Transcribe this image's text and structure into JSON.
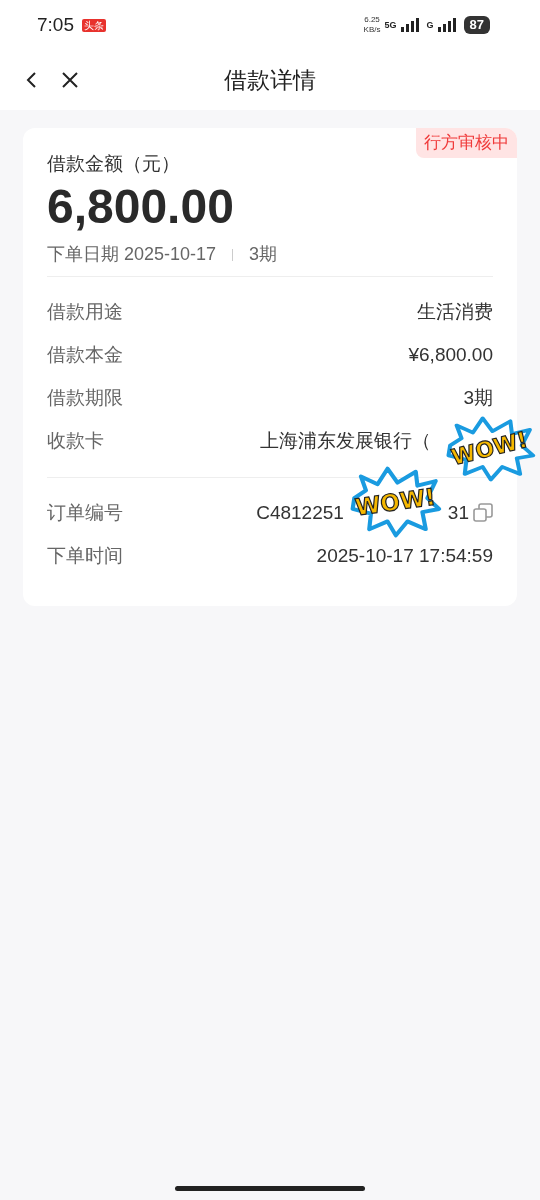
{
  "status_bar": {
    "time": "7:05",
    "app_badge": "头条",
    "net_speed": "6.25",
    "net_unit": "KB/s",
    "network_1": "5G",
    "network_2": "G",
    "battery": "87"
  },
  "header": {
    "title": "借款详情"
  },
  "card": {
    "status_tag": "行方审核中",
    "amount_label": "借款金额（元）",
    "amount": "6,800.00",
    "date_text": "下单日期 2025-10-17",
    "term_text": "3期",
    "rows": [
      {
        "kind": "plain",
        "label": "借款用途",
        "value": "生活消费"
      },
      {
        "kind": "plain",
        "label": "借款本金",
        "value": "¥6,800.00"
      },
      {
        "kind": "plain",
        "label": "借款期限",
        "value": "3期"
      },
      {
        "kind": "covered",
        "label": "收款卡",
        "value": "上海浦东发展银行（"
      }
    ],
    "order_rows": [
      {
        "kind": "copy",
        "label": "订单编号",
        "value": "C4812251",
        "value_end": "31"
      },
      {
        "kind": "plain",
        "label": "下单时间",
        "value": "2025-10-17 17:54:59"
      }
    ]
  },
  "stickers": [
    {
      "text": "WOW!"
    },
    {
      "text": "WOW!"
    }
  ]
}
